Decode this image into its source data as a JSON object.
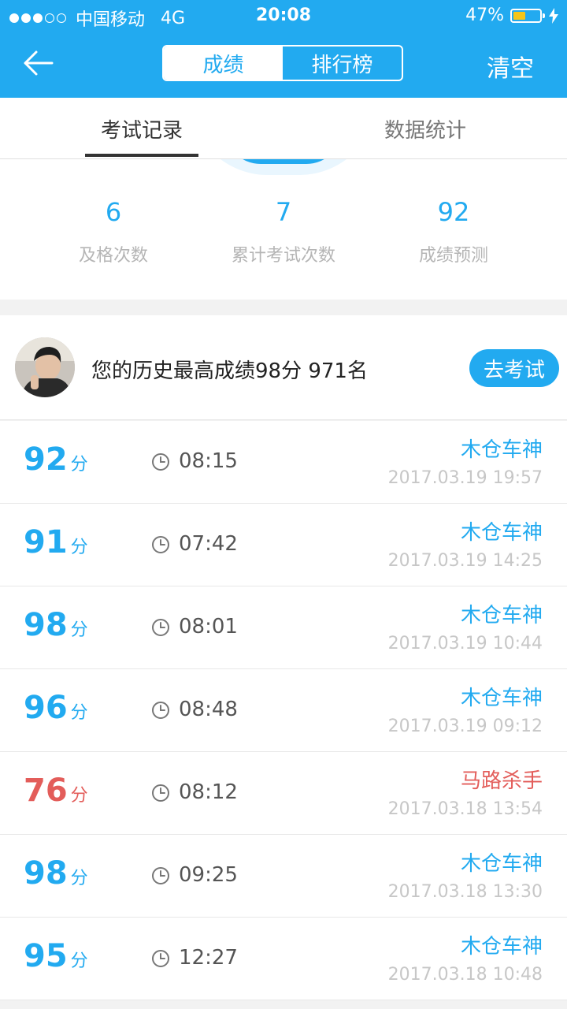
{
  "status_bar": {
    "carrier": "中国移动",
    "network": "4G",
    "time": "20:08",
    "battery": "47%",
    "battery_level": 0.47,
    "signal_dots": [
      true,
      true,
      true,
      false,
      false
    ]
  },
  "nav": {
    "segments": [
      "成绩",
      "排行榜"
    ],
    "active_segment": 0,
    "clear_label": "清空"
  },
  "tabs": {
    "items": [
      "考试记录",
      "数据统计"
    ],
    "active": 0
  },
  "stats": [
    {
      "value": "6",
      "label": "及格次数"
    },
    {
      "value": "7",
      "label": "累计考试次数"
    },
    {
      "value": "92",
      "label": "成绩预测"
    }
  ],
  "best": {
    "text": "您的历史最高成绩98分  971名",
    "button_label": "去考试"
  },
  "records": [
    {
      "score": "92",
      "unit": "分",
      "duration": "08:15",
      "title": "木仓车神",
      "date": "2017.03.19 19:57",
      "pass": true
    },
    {
      "score": "91",
      "unit": "分",
      "duration": "07:42",
      "title": "木仓车神",
      "date": "2017.03.19 14:25",
      "pass": true
    },
    {
      "score": "98",
      "unit": "分",
      "duration": "08:01",
      "title": "木仓车神",
      "date": "2017.03.19 10:44",
      "pass": true
    },
    {
      "score": "96",
      "unit": "分",
      "duration": "08:48",
      "title": "木仓车神",
      "date": "2017.03.19 09:12",
      "pass": true
    },
    {
      "score": "76",
      "unit": "分",
      "duration": "08:12",
      "title": "马路杀手",
      "date": "2017.03.18 13:54",
      "pass": false
    },
    {
      "score": "98",
      "unit": "分",
      "duration": "09:25",
      "title": "木仓车神",
      "date": "2017.03.18 13:30",
      "pass": true
    },
    {
      "score": "95",
      "unit": "分",
      "duration": "12:27",
      "title": "木仓车神",
      "date": "2017.03.18 10:48",
      "pass": true
    }
  ],
  "colors": {
    "accent": "#22aaf0",
    "fail": "#e35d5a"
  },
  "icons": {
    "back": "back-arrow-icon",
    "clock": "clock-icon",
    "battery": "battery-icon",
    "charging": "lightning-bolt-icon"
  }
}
